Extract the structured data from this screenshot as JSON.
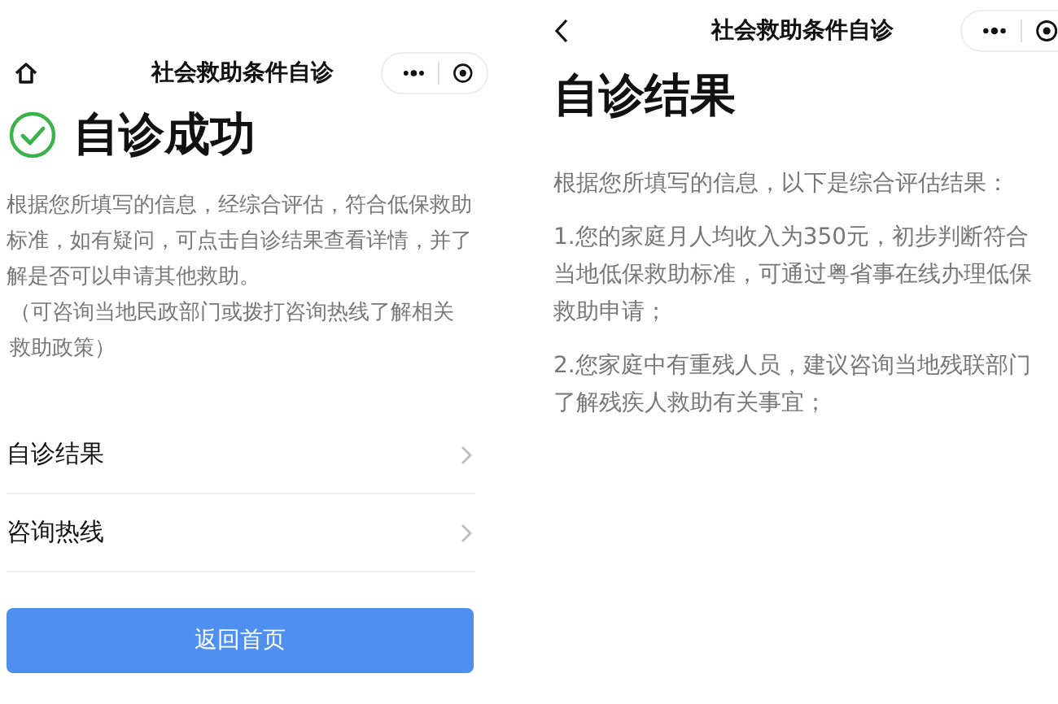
{
  "screens": [
    {
      "nav": {
        "title": "社会救助条件自诊",
        "kind": "home"
      },
      "heading": "自诊成功",
      "success": true,
      "paragraphs": [
        "根据您所填写的信息，经综合评估，符合低保救助标准，如有疑问，可点击自诊结果查看详情，并了解是否可以申请其他救助。",
        "（可咨询当地民政部门或拨打咨询热线了解相关救助政策）"
      ],
      "menu": [
        "自诊结果",
        "咨询热线"
      ],
      "button": "返回首页"
    },
    {
      "nav": {
        "title": "社会救助条件自诊",
        "kind": "back"
      },
      "heading": "自诊结果",
      "success": false,
      "paragraphs": [
        "根据您所填写的信息，以下是综合评估结果：",
        "1.您的家庭月人均收入为350元，初步判断符合当地低保救助标准，可通过粤省事在线办理低保救助申请；",
        "2.您家庭中有重残人员，建议咨询当地残联部门了解残疾人救助有关事宜；"
      ]
    }
  ]
}
